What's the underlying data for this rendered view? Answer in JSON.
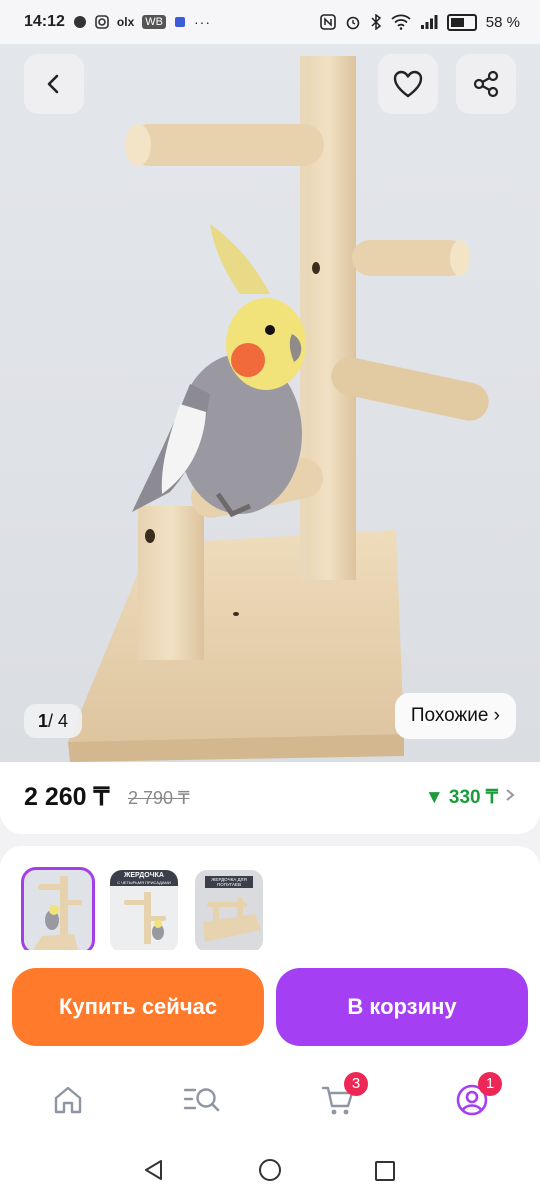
{
  "status_bar": {
    "time": "14:12",
    "left_badges": [
      "olx",
      "WB"
    ],
    "more": "···",
    "battery": "58 %"
  },
  "gallery": {
    "counter_current": "1",
    "counter_total": "/ 4",
    "similar_label": "Похожие ›"
  },
  "price": {
    "current": "2 260 ₸",
    "old": "2 790 ₸",
    "discount": "▼ 330 ₸"
  },
  "thumbnails": {
    "thumb2_caption": "ЖЕРДОЧКА",
    "thumb2_subcaption": "С ЧЕТЫРЬМЯ ПРИСАДАМИ",
    "thumb3_caption": "ЖЕРДОЧКА ДЛЯ ПОПУГАЕВ"
  },
  "actions": {
    "buy_now": "Купить сейчас",
    "add_to_cart": "В корзину"
  },
  "tabbar": {
    "cart_badge": "3",
    "profile_badge": "1"
  },
  "colors": {
    "buy_orange": "#ff7a2b",
    "cart_purple": "#a53ff3",
    "discount_green": "#1a9c3d",
    "badge_red": "#ee2856",
    "thumb_outline": "#a33ee8"
  },
  "icons": [
    "back-icon",
    "heart-icon",
    "share-icon",
    "chevron-right-icon",
    "home-icon",
    "catalog-search-icon",
    "cart-icon",
    "profile-icon",
    "nav-back-icon",
    "nav-home-icon",
    "nav-recents-icon"
  ]
}
